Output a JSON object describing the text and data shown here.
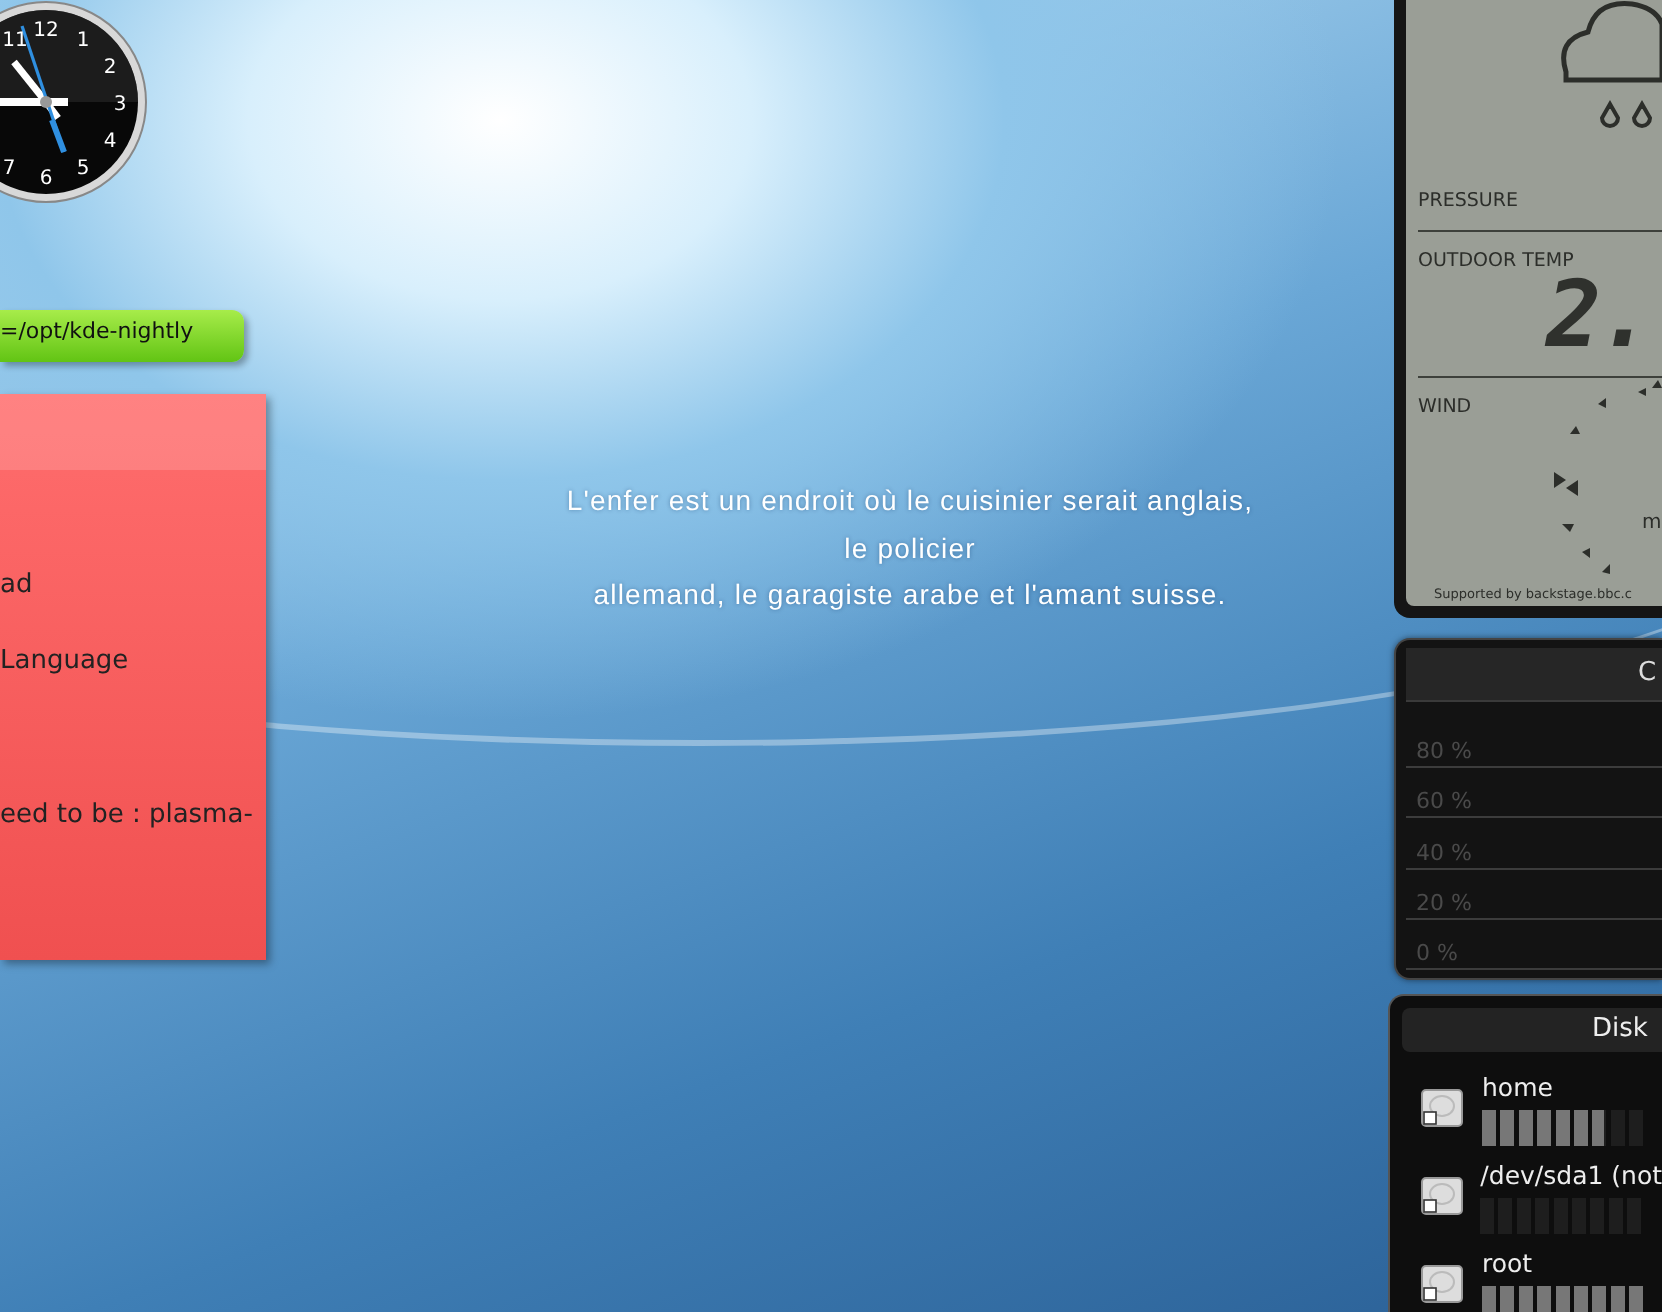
{
  "clock": {
    "numerals": [
      "12",
      "1",
      "2",
      "3",
      "4",
      "5",
      "6",
      "7",
      "11"
    ]
  },
  "path_bar": {
    "text": "=/opt/kde-nightly"
  },
  "note": {
    "lines": [
      "ad",
      "Language",
      "eed to be : plasma-"
    ]
  },
  "quote": {
    "text": "L'enfer est un endroit où le cuisinier serait anglais,\nle policier\nallemand, le garagiste arabe et l'amant suisse."
  },
  "weather": {
    "pressure_label": "PRESSURE",
    "outdoor_temp_label": "OUTDOOR TEMP",
    "temperature": "2.",
    "wind_label": "WIND",
    "wind_unit": "m",
    "credit": "Supported by backstage.bbc.c"
  },
  "cpu": {
    "title": "C",
    "gridlines": [
      "80 %",
      "60 %",
      "40 %",
      "20 %",
      "0 %"
    ]
  },
  "disks": {
    "title": "Disk",
    "items": [
      {
        "name": "home",
        "level": 0.74
      },
      {
        "name": "/dev/sda1 (not",
        "level": 0
      },
      {
        "name": "root",
        "level": 1.0
      }
    ]
  }
}
